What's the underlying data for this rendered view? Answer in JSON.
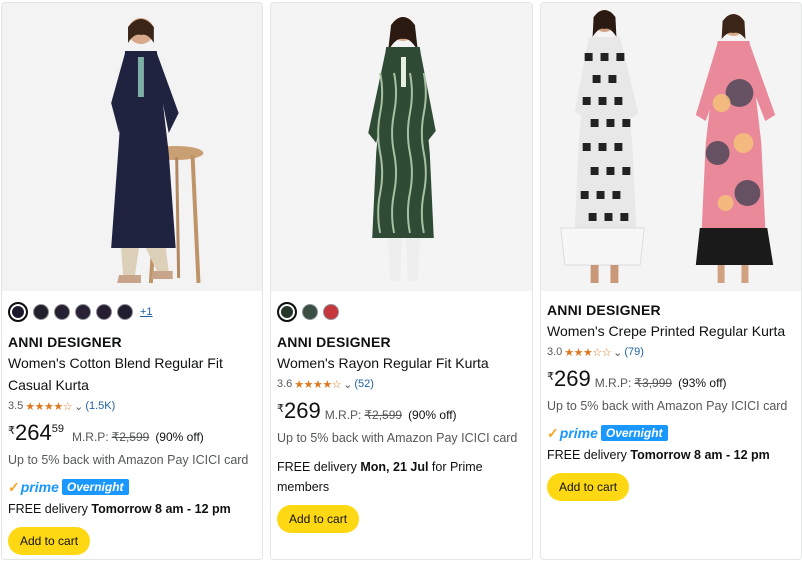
{
  "products": [
    {
      "brand": "ANNI DESIGNER",
      "title": "Women's Cotton Blend Regular Fit Casual Kurta",
      "rating": "3.5",
      "stars": "★★★★☆",
      "review_count": "(1.5K)",
      "currency": "₹",
      "price_whole": "264",
      "price_fraction": "59",
      "mrp_label": "M.R.P:",
      "mrp": "₹2,599",
      "discount": "(90% off)",
      "cashback": "Up to 5% back with Amazon Pay ICICI card",
      "prime_label": "prime",
      "overnight_label": "Overnight",
      "delivery_prefix": "FREE delivery ",
      "delivery_date": "Tomorrow 8 am - 12 pm",
      "delivery_suffix": "",
      "cart_label": "Add to cart",
      "more_colors": "+1",
      "swatch_colors": [
        "#1e1a2e",
        "#23202d",
        "#262033",
        "#2a2136",
        "#251e30",
        "#221d2e"
      ]
    },
    {
      "brand": "ANNI DESIGNER",
      "title": "Women's Rayon Regular Fit Kurta",
      "rating": "3.6",
      "stars": "★★★★☆",
      "review_count": "(52)",
      "currency": "₹",
      "price_whole": "269",
      "price_fraction": "",
      "mrp_label": "M.R.P:",
      "mrp": "₹2,599",
      "discount": "(90% off)",
      "cashback": "Up to 5% back with Amazon Pay ICICI card",
      "delivery_prefix": "FREE delivery ",
      "delivery_date": "Mon, 21 Jul",
      "delivery_suffix": " for Prime members",
      "cart_label": "Add to cart",
      "swatch_colors": [
        "#26362a",
        "#3b4f45",
        "#c6363d"
      ]
    },
    {
      "brand": "ANNI DESIGNER",
      "title": "Women's Crepe Printed Regular Kurta",
      "rating": "3.0",
      "stars": "★★★☆☆",
      "review_count": "(79)",
      "currency": "₹",
      "price_whole": "269",
      "price_fraction": "",
      "mrp_label": "M.R.P:",
      "mrp": "₹3,999",
      "discount": "(93% off)",
      "cashback": "Up to 5% back with Amazon Pay ICICI card",
      "prime_label": "prime",
      "overnight_label": "Overnight",
      "delivery_prefix": "FREE delivery ",
      "delivery_date": "Tomorrow 8 am - 12 pm",
      "delivery_suffix": "",
      "cart_label": "Add to cart"
    }
  ],
  "colors": {
    "star": "#de7921",
    "link": "#2162a1",
    "prime_blue": "#1a98ff",
    "prime_check": "#f5a623",
    "cart_button": "#ffd814"
  }
}
